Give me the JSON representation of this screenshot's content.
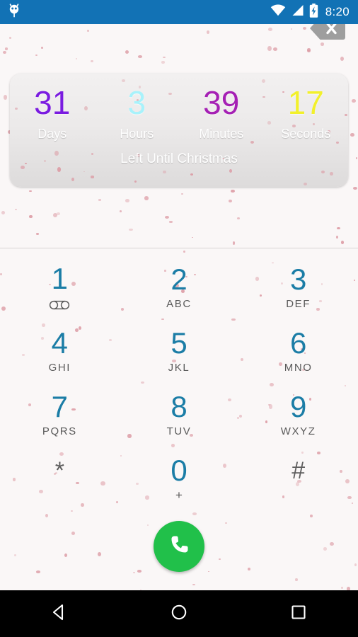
{
  "status_bar": {
    "background_color": "#1272b5",
    "notification_icon": "android-robot-icon",
    "wifi_icon": "wifi-icon",
    "signal_icon": "cellular-signal-icon",
    "battery_icon": "battery-charging-icon",
    "clock": "8:20"
  },
  "widget": {
    "name": "christmas-countdown-widget",
    "footer_text": "Left Until Christmas",
    "units": [
      {
        "value": "31",
        "label": "Days",
        "color": "#7a1be0"
      },
      {
        "value": "3",
        "label": "Hours",
        "color": "#a8f2fb"
      },
      {
        "value": "39",
        "label": "Minutes",
        "color": "#a520b4"
      },
      {
        "value": "17",
        "label": "Seconds",
        "color": "#f2f02b"
      }
    ]
  },
  "dialer": {
    "input_value": "",
    "input_placeholder": "",
    "backspace_icon": "backspace-delete-icon",
    "keys": [
      {
        "digit": "1",
        "sub": "",
        "sub_icon": "voicemail-icon",
        "gray": false
      },
      {
        "digit": "2",
        "sub": "ABC",
        "sub_icon": "",
        "gray": false
      },
      {
        "digit": "3",
        "sub": "DEF",
        "sub_icon": "",
        "gray": false
      },
      {
        "digit": "4",
        "sub": "GHI",
        "sub_icon": "",
        "gray": false
      },
      {
        "digit": "5",
        "sub": "JKL",
        "sub_icon": "",
        "gray": false
      },
      {
        "digit": "6",
        "sub": "MNO",
        "sub_icon": "",
        "gray": false
      },
      {
        "digit": "7",
        "sub": "PQRS",
        "sub_icon": "",
        "gray": false
      },
      {
        "digit": "8",
        "sub": "TUV",
        "sub_icon": "",
        "gray": false
      },
      {
        "digit": "9",
        "sub": "WXYZ",
        "sub_icon": "",
        "gray": false
      },
      {
        "digit": "*",
        "sub": "",
        "sub_icon": "",
        "gray": true
      },
      {
        "digit": "0",
        "sub": "+",
        "sub_icon": "",
        "gray": false
      },
      {
        "digit": "#",
        "sub": "",
        "sub_icon": "",
        "gray": true
      }
    ],
    "call_button": {
      "icon": "phone-handset-icon",
      "color": "#21c04a"
    },
    "digit_color": "#1b7da6",
    "letter_color": "#5a5a5a"
  },
  "nav_bar": {
    "background_color": "#000000",
    "back_icon": "back-triangle-icon",
    "home_icon": "home-circle-icon",
    "recents_icon": "recents-square-icon"
  },
  "background": {
    "page_color": "#faf7f7",
    "confetti_color": "#dc9aa3"
  }
}
